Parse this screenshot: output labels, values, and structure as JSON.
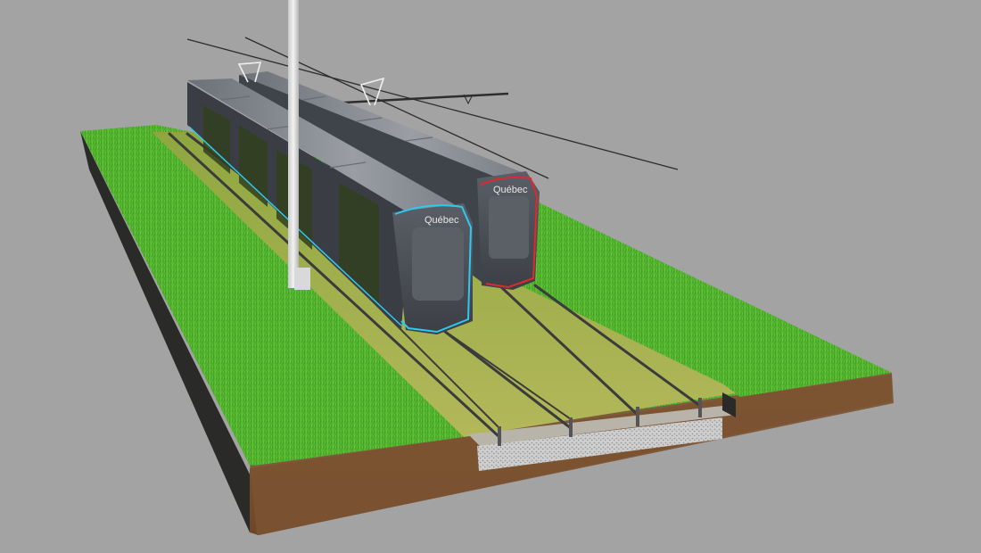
{
  "scene": {
    "tram_left_brand": "Québec",
    "tram_right_brand": "Québec",
    "colors": {
      "background": "#a3a3a3",
      "grass": "#4fae2c",
      "grass_dry": "#9fb04a",
      "soil": "#7b5332",
      "tram_body": "#4a4e55",
      "tram_roof": "#8c9096",
      "accent_left": "#2ec9f0",
      "accent_right": "#e0282e",
      "rail": "#3b3b3b",
      "gravel": "#cfcfcf",
      "concrete": "#b9b4aa"
    }
  }
}
